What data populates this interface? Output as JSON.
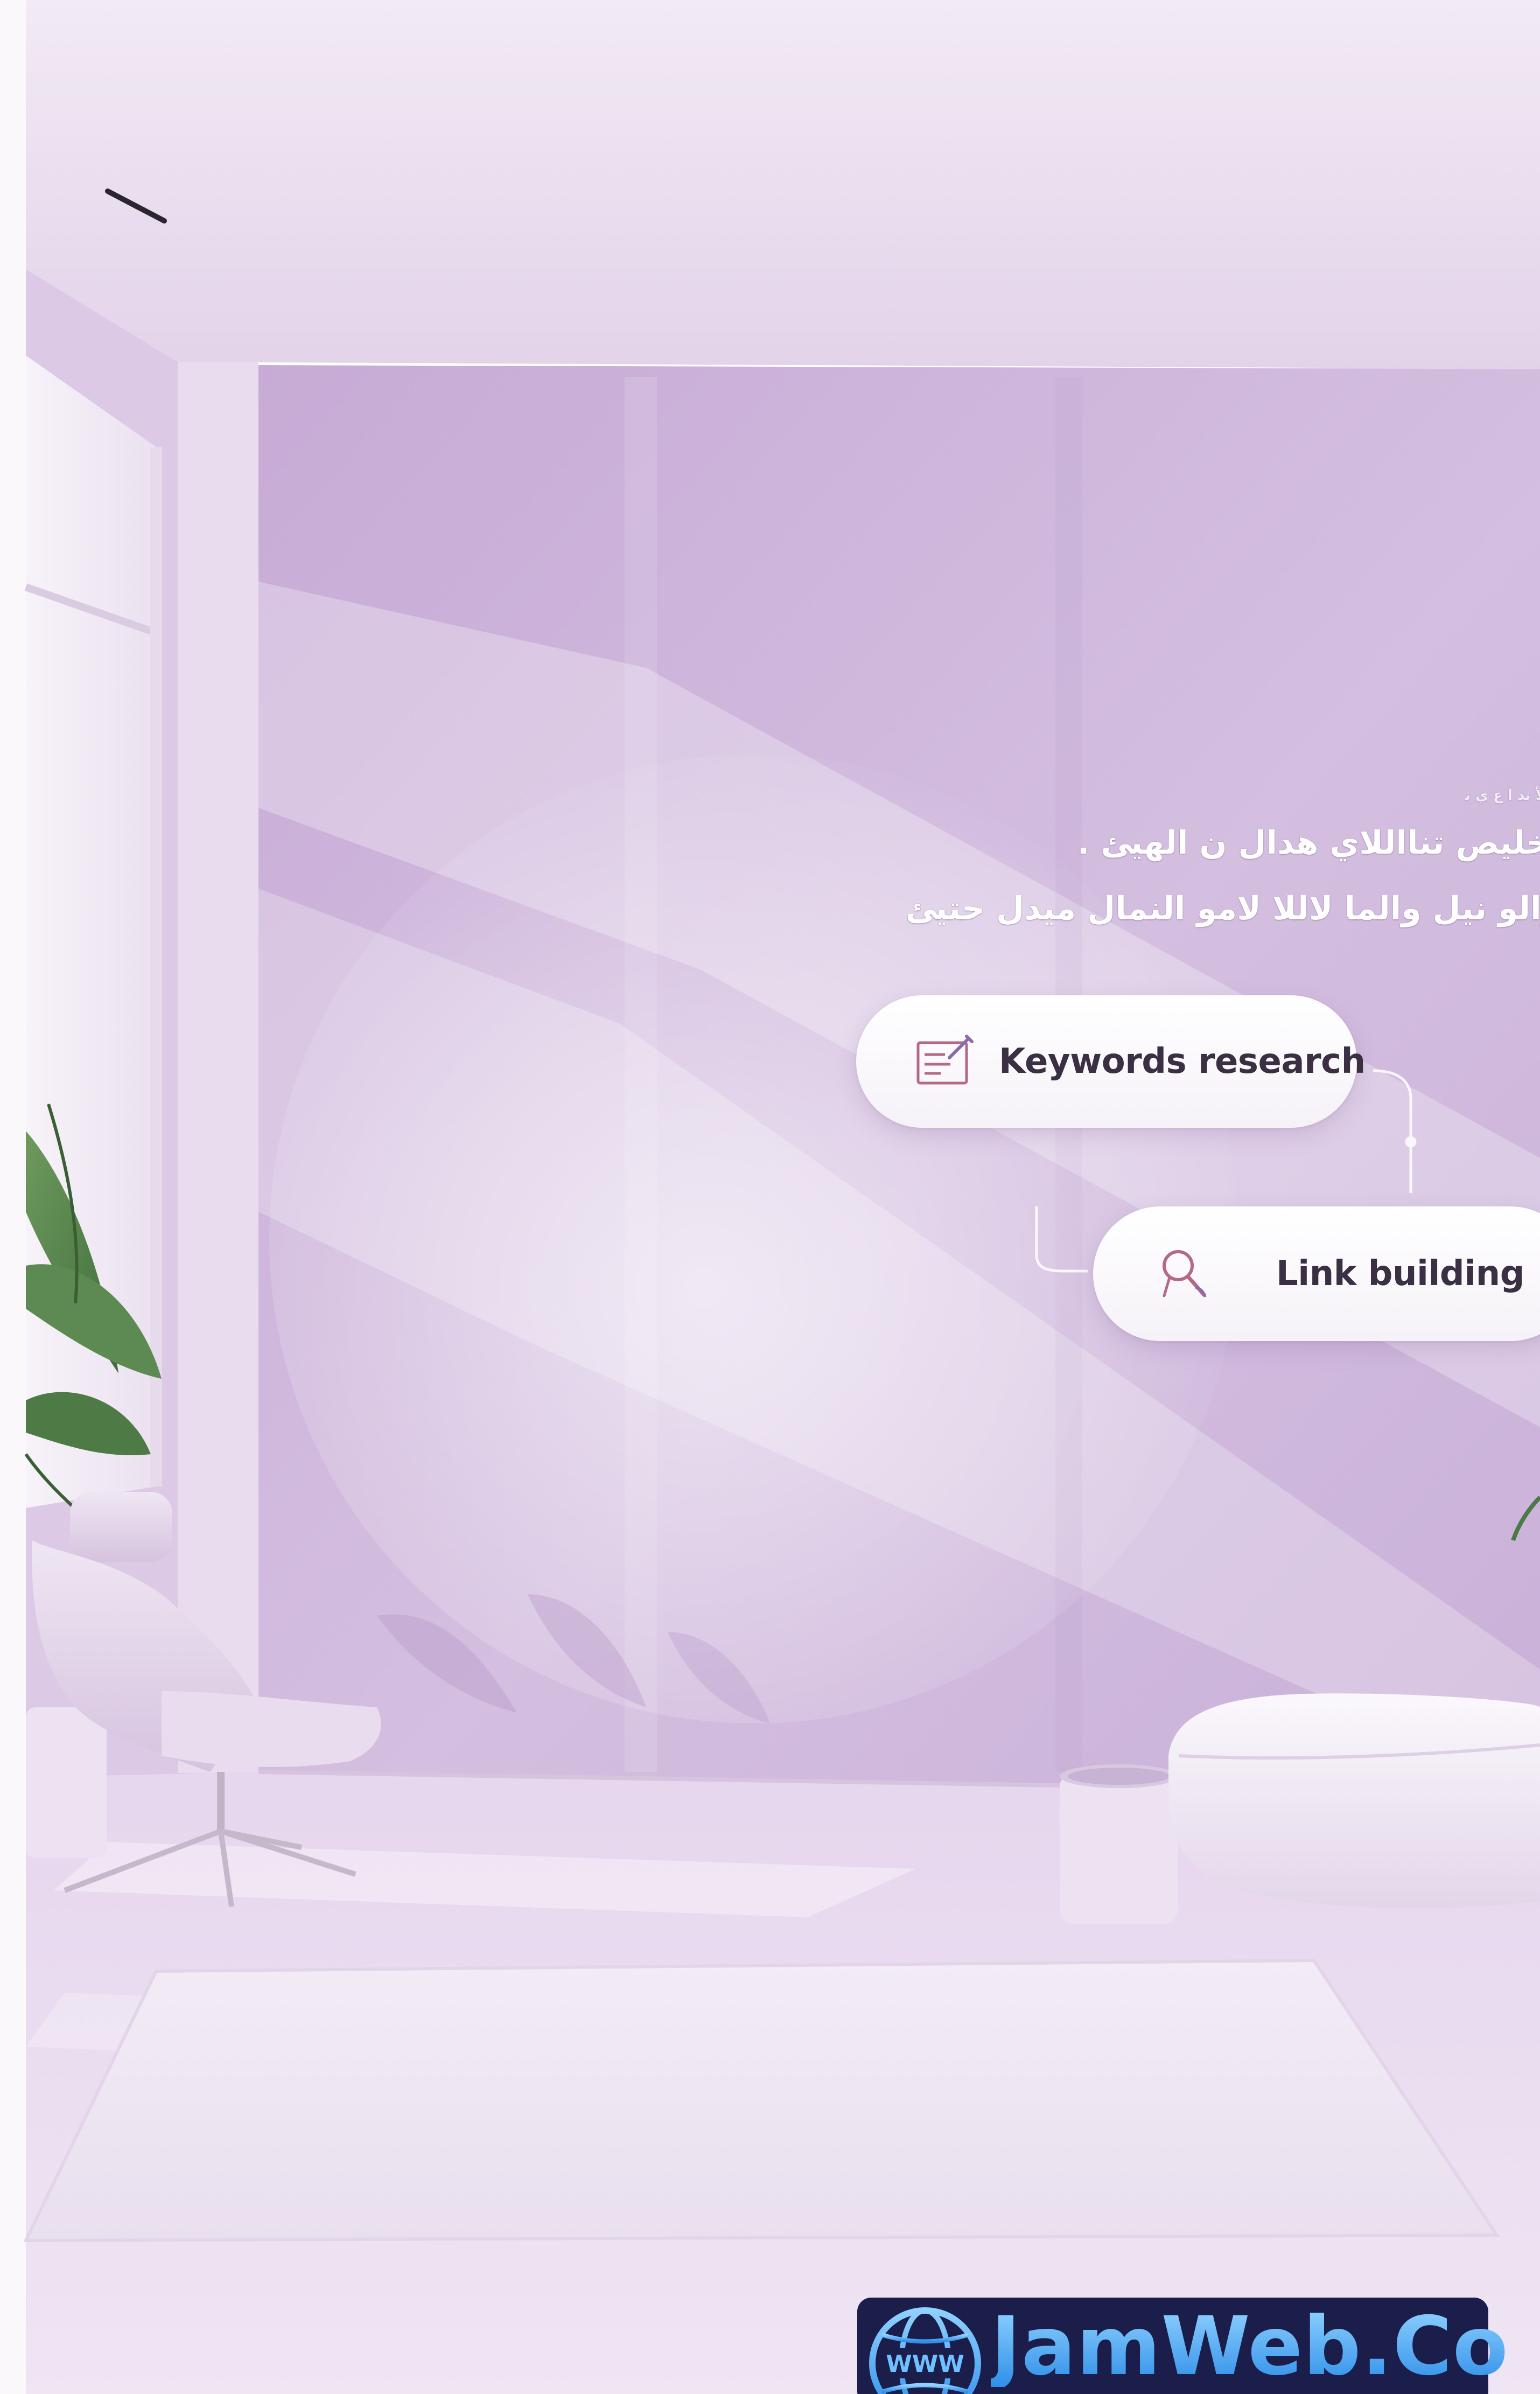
{
  "wall": {
    "small_caption": "ﺍﻷ ﻧﺪ ﺍ ﻉ ﻱ ﻧ",
    "line_1": "ﺗﺨﻠﻴﺺ ﺗﻨﺎﺍﻟﻼﻱ ﻫﺪﺍﻝ ﻥ ﺍﻟﻬﻴﺊ .",
    "line_2": "ﻭﺍﻟﻮ ﻧﻴﻞ ﻭﺍﻟﻤﺎ ﻻﻟﻼ ﻟﺎﻣﻮ ﺍﻟﻨﻤﺎﻝ ﻣﻴﺪﻝ ﺣﺘﻴﺊ"
  },
  "pills": [
    {
      "label": "Keywords research",
      "icon": "document-edit-icon"
    },
    {
      "label": "Link building",
      "icon": "magnifier-icon"
    }
  ],
  "logo": {
    "text": "JamWeb.Co",
    "globe_text": "WWW",
    "icon": "globe-icon"
  },
  "colors": {
    "wall": "#cbb1d8",
    "floor": "#e7dbed",
    "logo_background": "#1b1d4b",
    "logo_text": "#5fb3ff"
  }
}
